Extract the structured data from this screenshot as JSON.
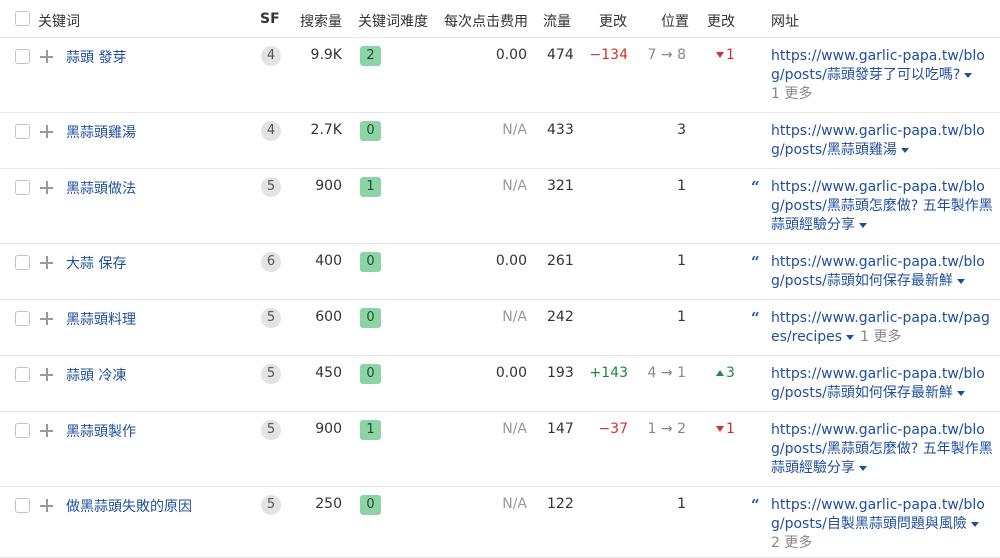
{
  "headers": {
    "keyword": "关键词",
    "sf": "SF",
    "volume": "搜索量",
    "kd": "关键词难度",
    "cpc": "每次点击费用",
    "traffic": "流量",
    "traffic_change": "更改",
    "position": "位置",
    "position_change": "更改",
    "url": "网址"
  },
  "rows": [
    {
      "keyword": "蒜頭 發芽",
      "sf": "4",
      "volume": "9.9K",
      "kd": "2",
      "cpc": "0.00",
      "traffic": "474",
      "traffic_change": "−134",
      "position": "7 → 8",
      "position_change": "1",
      "url": "https://www.garlic-papa.tw/blog/posts/蒜頭發芽了可以吃嗎?",
      "more": "1 更多"
    },
    {
      "keyword": "黑蒜頭雞湯",
      "sf": "4",
      "volume": "2.7K",
      "kd": "0",
      "cpc": "N/A",
      "traffic": "433",
      "traffic_change": "",
      "position": "3",
      "position_change": "",
      "url": "https://www.garlic-papa.tw/blog/posts/黑蒜頭雞湯",
      "more": ""
    },
    {
      "keyword": "黑蒜頭做法",
      "sf": "5",
      "volume": "900",
      "kd": "1",
      "cpc": "N/A",
      "traffic": "321",
      "traffic_change": "",
      "position": "1",
      "position_change": "",
      "url": "https://www.garlic-papa.tw/blog/posts/黑蒜頭怎麼做? 五年製作黑蒜頭經驗分享",
      "more": ""
    },
    {
      "keyword": "大蒜 保存",
      "sf": "6",
      "volume": "400",
      "kd": "0",
      "cpc": "0.00",
      "traffic": "261",
      "traffic_change": "",
      "position": "1",
      "position_change": "",
      "url": "https://www.garlic-papa.tw/blog/posts/蒜頭如何保存最新鮮",
      "more": ""
    },
    {
      "keyword": "黑蒜頭料理",
      "sf": "5",
      "volume": "600",
      "kd": "0",
      "cpc": "N/A",
      "traffic": "242",
      "traffic_change": "",
      "position": "1",
      "position_change": "",
      "url": "https://www.garlic-papa.tw/pages/recipes",
      "more": "1 更多"
    },
    {
      "keyword": "蒜頭 冷凍",
      "sf": "5",
      "volume": "450",
      "kd": "0",
      "cpc": "0.00",
      "traffic": "193",
      "traffic_change": "+143",
      "position": "4 → 1",
      "position_change": "3",
      "url": "https://www.garlic-papa.tw/blog/posts/蒜頭如何保存最新鮮",
      "more": ""
    },
    {
      "keyword": "黑蒜頭製作",
      "sf": "5",
      "volume": "900",
      "kd": "1",
      "cpc": "N/A",
      "traffic": "147",
      "traffic_change": "−37",
      "position": "1 → 2",
      "position_change": "1",
      "url": "https://www.garlic-papa.tw/blog/posts/黑蒜頭怎麼做? 五年製作黑蒜頭經驗分享",
      "more": ""
    },
    {
      "keyword": "做黑蒜頭失敗的原因",
      "sf": "5",
      "volume": "250",
      "kd": "0",
      "cpc": "N/A",
      "traffic": "122",
      "traffic_change": "",
      "position": "1",
      "position_change": "",
      "url": "https://www.garlic-papa.tw/blog/posts/自製黑蒜頭問題與風險",
      "more": "2 更多"
    }
  ],
  "colors": {
    "link": "#1f4f9c",
    "negative": "#d62f2f",
    "positive": "#1f8a3b",
    "kd_badge": "#8cd4a5",
    "sf_badge": "#e3e3e3"
  }
}
